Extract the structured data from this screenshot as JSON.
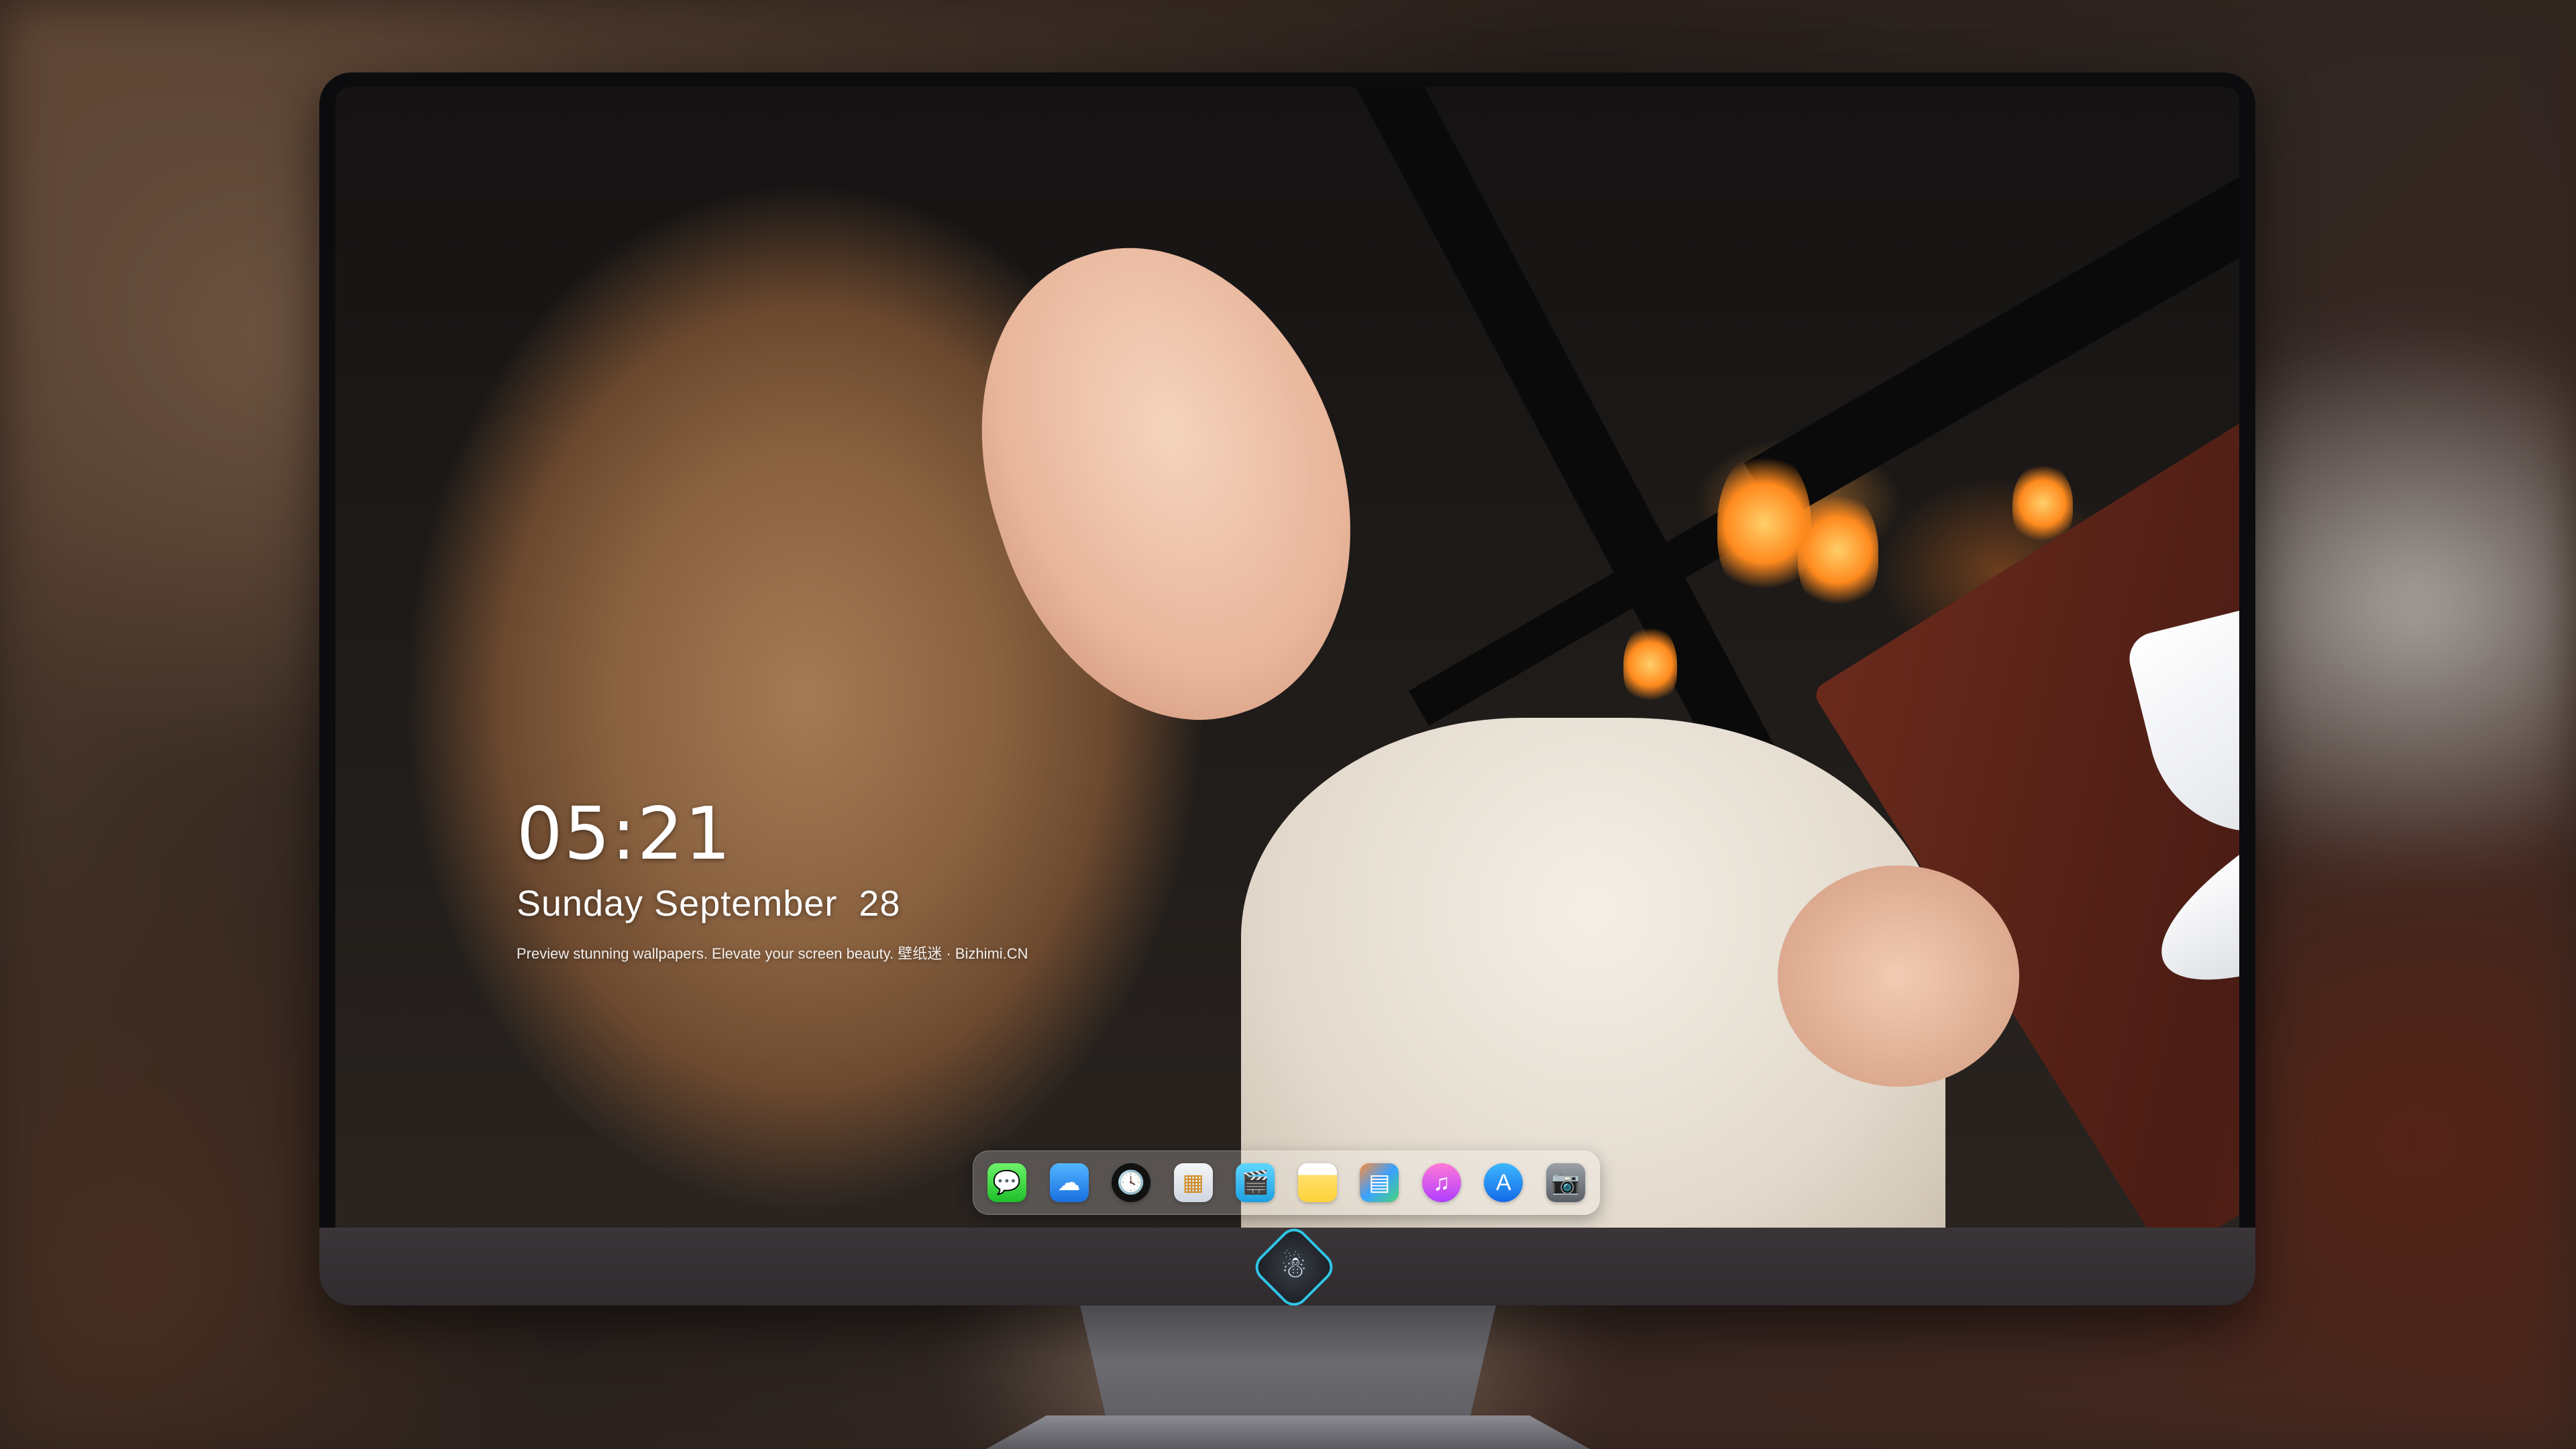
{
  "lock_screen": {
    "time": "05:21",
    "date": "Sunday September  28",
    "tagline": "Preview stunning wallpapers. Elevate your screen beauty. 壁纸迷 · Bizhimi.CN"
  },
  "dock": {
    "apps": [
      {
        "name": "messages-icon",
        "glyph": "💬"
      },
      {
        "name": "weather-icon",
        "glyph": "☁"
      },
      {
        "name": "clock-icon",
        "glyph": "🕓"
      },
      {
        "name": "preview-icon",
        "glyph": "▦"
      },
      {
        "name": "clips-icon",
        "glyph": "🎬"
      },
      {
        "name": "notes-icon",
        "glyph": ""
      },
      {
        "name": "keynote-icon",
        "glyph": "▤"
      },
      {
        "name": "music-icon",
        "glyph": "♫"
      },
      {
        "name": "app-store-icon",
        "glyph": "A"
      },
      {
        "name": "camera-icon",
        "glyph": "📷"
      }
    ]
  },
  "chin_logo": {
    "glyph": "☃"
  },
  "colors": {
    "bezel": "#0c0c0e",
    "chin": "#3a3538",
    "logo_ring": "#2ec6e8"
  }
}
